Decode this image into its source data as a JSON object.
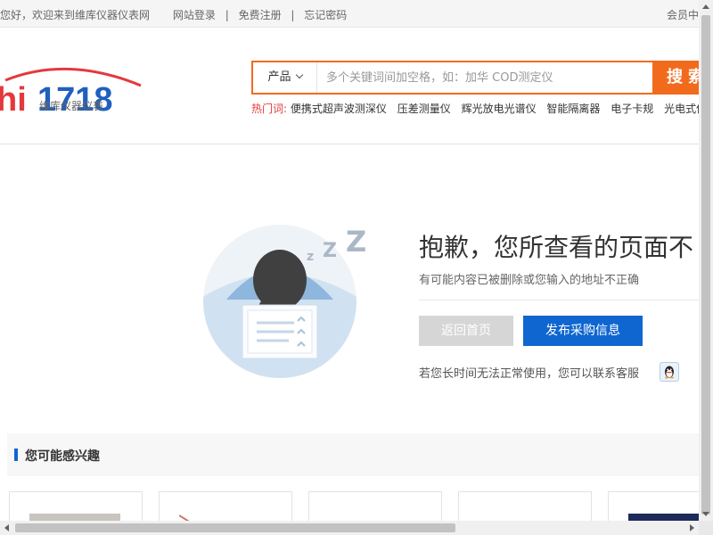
{
  "topbar": {
    "welcome": "您好，欢迎来到维库仪器仪表网",
    "login": "网站登录",
    "register": "免费注册",
    "forgot": "忘记密码",
    "member": "会员中"
  },
  "logo": {
    "brand": "hi1718",
    "tagline": "维库仪器仪表"
  },
  "search": {
    "category": "产品",
    "placeholder": "多个关键词间加空格，如：加华 COD测定仪",
    "button": "搜索"
  },
  "hot": {
    "label": "热门词:",
    "items": [
      "便携式超声波测深仪",
      "压差测量仪",
      "辉光放电光谱仪",
      "智能隔离器",
      "电子卡规",
      "光电式传感"
    ]
  },
  "error": {
    "title": "抱歉，您所查看的页面不",
    "subtitle": "有可能内容已被删除或您输入的地址不正确",
    "home_button": "返回首页",
    "post_button": "发布采购信息",
    "contact": "若您长时间无法正常使用，您可以联系客服"
  },
  "interest": {
    "title": "您可能感兴趣"
  },
  "colors": {
    "accent_orange": "#f26b1d",
    "accent_blue": "#0f66d0",
    "hot_red": "#e4393c"
  }
}
